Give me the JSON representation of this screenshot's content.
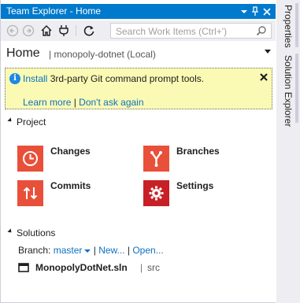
{
  "titlebar": {
    "title": "Team Explorer - Home",
    "icons": [
      "dropdown-arrow-icon",
      "pin-icon",
      "close-icon"
    ]
  },
  "toolbar": {
    "icons": [
      "back-icon",
      "forward-icon",
      "home-icon",
      "connect-icon",
      "refresh-icon"
    ],
    "search_placeholder": "Search Work Items (Ctrl+')"
  },
  "home": {
    "title": "Home",
    "subtitle": "| monopoly-dotnet (Local)"
  },
  "infobar": {
    "install_link": "Install",
    "message": " 3rd-party Git command prompt tools.",
    "learn_more": "Learn more",
    "separator": " | ",
    "dont_ask": "Don't ask again",
    "close_glyph": "✕"
  },
  "project": {
    "header": "Project",
    "tiles": [
      {
        "label": "Changes",
        "icon": "clock-icon",
        "color": "#e8503a"
      },
      {
        "label": "Branches",
        "icon": "branch-icon",
        "color": "#e8503a"
      },
      {
        "label": "Commits",
        "icon": "up-down-arrows-icon",
        "color": "#e8503a"
      },
      {
        "label": "Settings",
        "icon": "gear-icon",
        "color": "#c72027"
      }
    ]
  },
  "solutions": {
    "header": "Solutions",
    "branch_label": "Branch: ",
    "branch_value": "master",
    "new_link": "New...",
    "separator": " | ",
    "open_link": "Open...",
    "solution_name": "MonopolyDotNet.sln",
    "solution_sep": "|",
    "solution_dir": "src"
  },
  "dock": {
    "tabs": [
      "Properties",
      "Solution Explorer"
    ]
  },
  "colors": {
    "accent": "#007acc",
    "link": "#0e70c0",
    "infobar_bg": "#fafab4",
    "tile_red": "#e8503a",
    "tile_darkred": "#c72027"
  }
}
